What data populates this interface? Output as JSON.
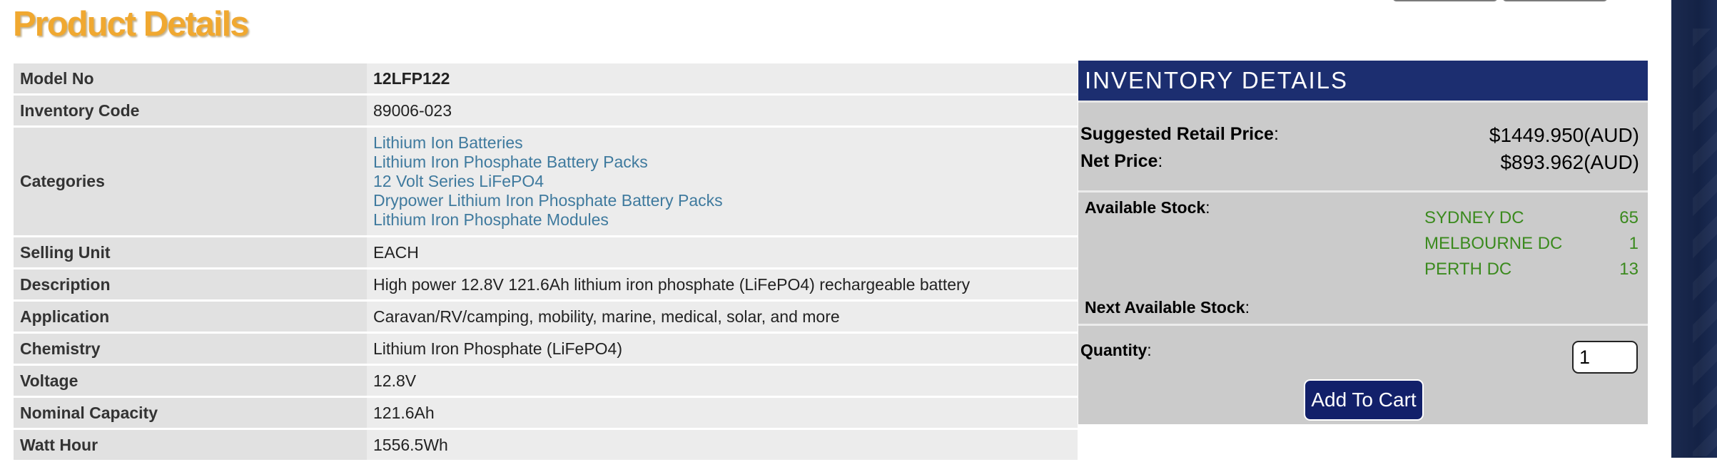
{
  "page": {
    "title": "Product Details"
  },
  "details": {
    "model_no": {
      "label": "Model No",
      "value": "12LFP122"
    },
    "inventory_code": {
      "label": "Inventory Code",
      "value": "89006-023"
    },
    "categories": {
      "label": "Categories",
      "items": [
        "Lithium Ion Batteries",
        "Lithium Iron Phosphate Battery Packs",
        "12 Volt Series LiFePO4",
        "Drypower Lithium Iron Phosphate Battery Packs",
        "Lithium Iron Phosphate Modules"
      ]
    },
    "selling_unit": {
      "label": "Selling Unit",
      "value": "EACH"
    },
    "description": {
      "label": "Description",
      "value": "High power 12.8V 121.6Ah lithium iron phosphate (LiFePO4) rechargeable battery"
    },
    "application": {
      "label": "Application",
      "value": "Caravan/RV/camping, mobility, marine, medical, solar, and more"
    },
    "chemistry": {
      "label": "Chemistry",
      "value": "Lithium Iron Phosphate (LiFePO4)"
    },
    "voltage": {
      "label": "Voltage",
      "value": "12.8V"
    },
    "nominal_capacity": {
      "label": "Nominal Capacity",
      "value": "121.6Ah"
    },
    "watt_hour": {
      "label": "Watt Hour",
      "value": "1556.5Wh"
    }
  },
  "inventory": {
    "title": "INVENTORY DETAILS",
    "suggested_retail": {
      "label": "Suggested Retail Price",
      "value": "$1449.950(AUD)"
    },
    "net_price": {
      "label": "Net Price",
      "value": "$893.962(AUD)"
    },
    "available_stock_label": "Available Stock",
    "stock": [
      {
        "dc": "SYDNEY DC",
        "qty": "65"
      },
      {
        "dc": "MELBOURNE DC",
        "qty": "1"
      },
      {
        "dc": "PERTH DC",
        "qty": "13"
      }
    ],
    "next_available_label": "Next Available Stock",
    "quantity_label": "Quantity",
    "quantity_value": "1",
    "add_to_cart_label": "Add To Cart"
  },
  "colors": {
    "title": "#f0a830",
    "link": "#3f7a9e",
    "stock": "#3b8a1e",
    "inventory_header": "#1c2e70",
    "button": "#12206a"
  }
}
